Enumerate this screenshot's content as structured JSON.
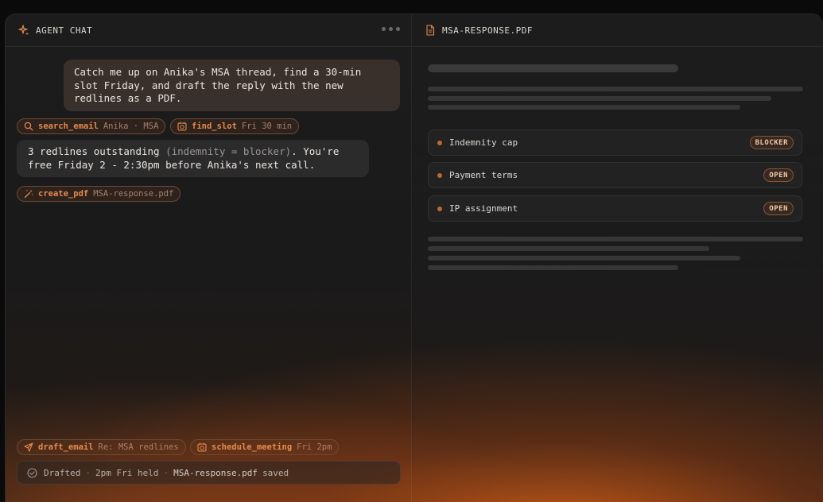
{
  "chat": {
    "title": "AGENT CHAT",
    "user_message": "Catch me up on Anika's MSA thread, find a 30-min slot Friday, and draft the reply with the new redlines as a PDF.",
    "agent_message_a": "3 redlines outstanding ",
    "agent_message_b": "(indemnity = blocker)",
    "agent_message_c": ". You're free Friday 2 - 2:30pm before Anika's next call."
  },
  "tools": {
    "search_email": {
      "name": "search_email",
      "arg": "Anika · MSA"
    },
    "find_slot": {
      "name": "find_slot",
      "arg": "Fri 30 min"
    },
    "create_pdf": {
      "name": "create_pdf",
      "arg": "MSA-response.pdf"
    },
    "draft_email": {
      "name": "draft_email",
      "arg": "Re: MSA redlines"
    },
    "schedule_meeting": {
      "name": "schedule_meeting",
      "arg": "Fri 2pm"
    }
  },
  "status": {
    "part1": "Drafted",
    "part2": "2pm Fri held",
    "part3_file": "MSA-response.pdf",
    "part3_word": "saved"
  },
  "document": {
    "title": "MSA-RESPONSE.PDF",
    "issues": [
      {
        "label": "Indemnity cap",
        "badge": "BLOCKER"
      },
      {
        "label": "Payment terms",
        "badge": "OPEN"
      },
      {
        "label": "IP assignment",
        "badge": "OPEN"
      }
    ]
  },
  "colors": {
    "accent": "#e58a4e",
    "glow": "#d66018"
  }
}
